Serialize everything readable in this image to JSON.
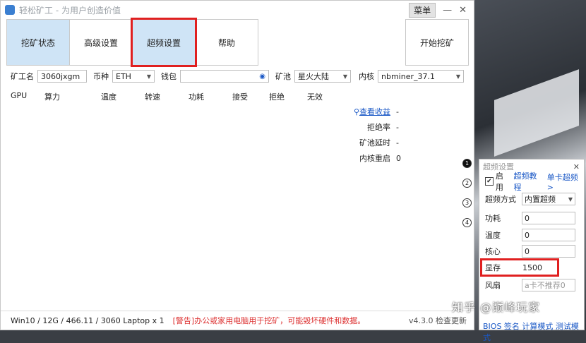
{
  "window": {
    "title": "轻松矿工 - 为用户创造价值",
    "menu_label": "菜单"
  },
  "tabs": [
    {
      "label": "挖矿状态"
    },
    {
      "label": "高级设置"
    },
    {
      "label": "超频设置"
    },
    {
      "label": "帮助"
    }
  ],
  "start_button": "开始挖矿",
  "config": {
    "worker_label": "矿工名",
    "worker_value": "3060jxgm",
    "coin_label": "币种",
    "coin_value": "ETH",
    "wallet_label": "钱包",
    "wallet_value": "",
    "pool_label": "矿池",
    "pool_value": "星火大陆",
    "kernel_label": "内核",
    "kernel_value": "nbminer_37.1"
  },
  "gpu_columns": [
    "GPU",
    "算力",
    "温度",
    "转速",
    "功耗",
    "接受",
    "拒绝",
    "无效"
  ],
  "stats": {
    "view_earnings": "查看收益",
    "view_earnings_value": "-",
    "reject_rate": "拒绝率",
    "reject_rate_value": "-",
    "pool_latency": "矿池延时",
    "pool_latency_value": "-",
    "kernel_restart": "内核重启",
    "kernel_restart_value": "0"
  },
  "side_numbers": [
    "1",
    "2",
    "3",
    "4"
  ],
  "statusbar": {
    "sys": "Win10  / 12G / 466.11 / 3060 Laptop x 1",
    "warning": "[警告]办公或家用电脑用于挖矿，可能毁坏硬件和数据。",
    "version": "v4.3.0 检查更新"
  },
  "oc_panel": {
    "title": "超频设置",
    "enable_label": "启用",
    "tutorial_link": "超频教程",
    "single_card_link": "单卡超频>",
    "mode_label": "超频方式",
    "mode_value": "内置超频",
    "power_label": "功耗",
    "power_value": "0",
    "temp_label": "温度",
    "temp_value": "0",
    "core_label": "核心",
    "core_value": "0",
    "mem_label": "显存",
    "mem_value": "1500",
    "fan_label": "风扇",
    "fan_placeholder": "a卡不推荐0",
    "bios_text": "BIOS 签名 计算模式 测试模式"
  },
  "watermark": "知乎 @巅峰玩家",
  "colors": {
    "accent": "#cfe4f6",
    "highlight": "#e02020",
    "link": "#1a58c6"
  }
}
